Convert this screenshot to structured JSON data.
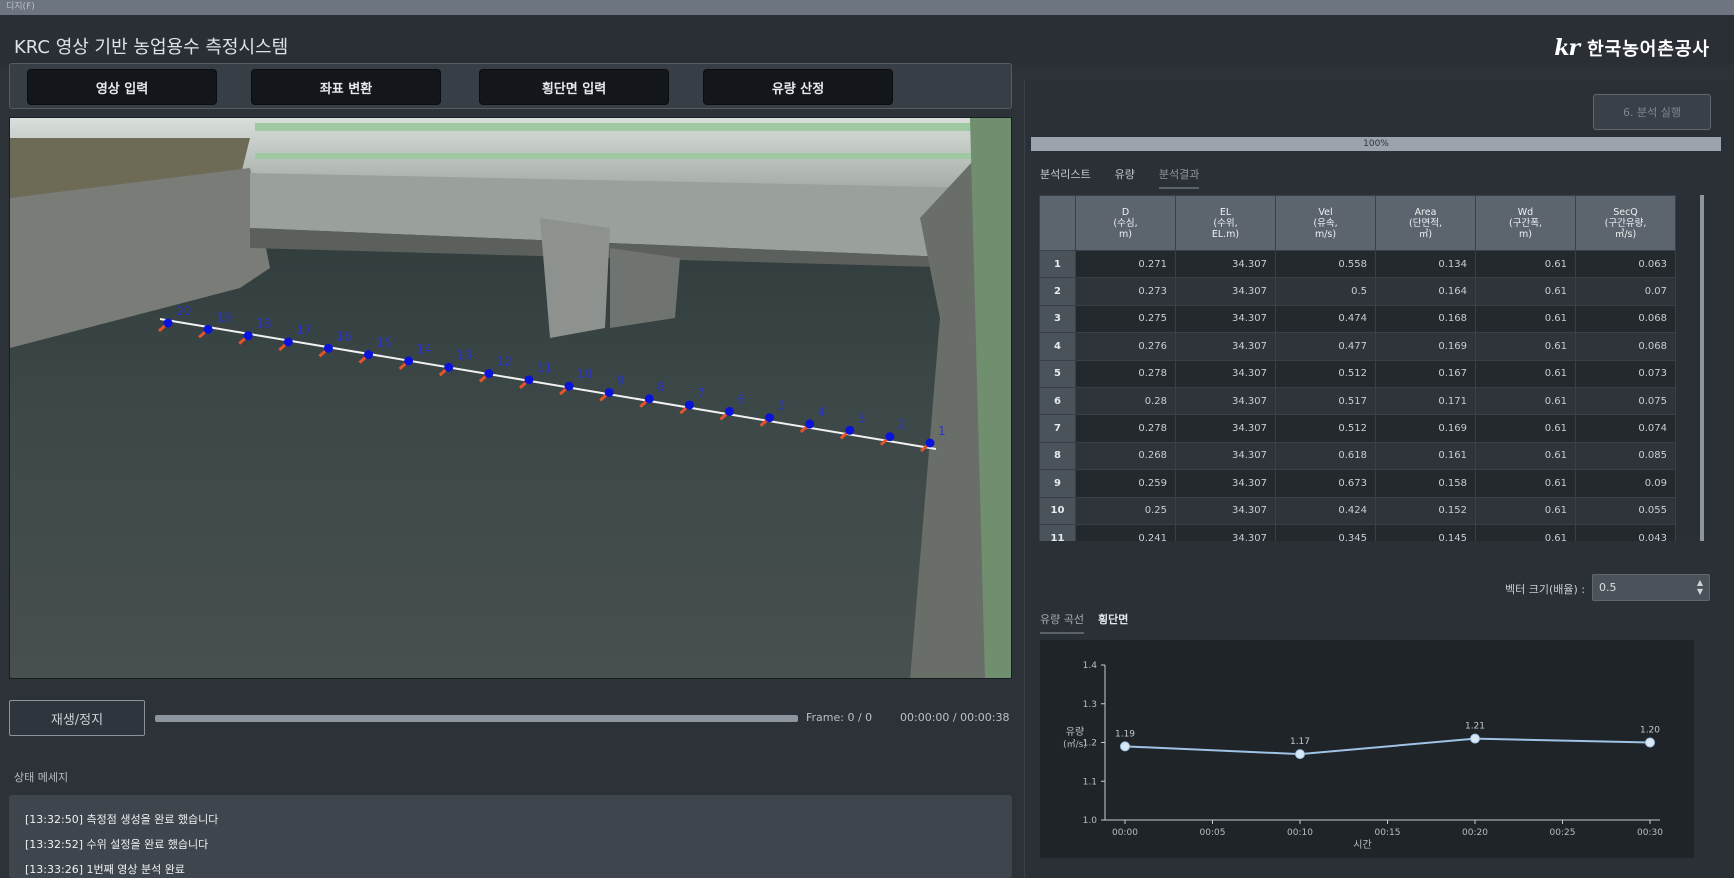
{
  "window": {
    "title": "디지(F)"
  },
  "app": {
    "title": "KRC 영상 기반 농업용수 측정시스템",
    "logo_mark": "kr",
    "logo_text": "한국농어촌공사"
  },
  "toolbar": {
    "buttons": [
      "영상 입력",
      "좌표 변환",
      "횡단면 입력",
      "유량 산정"
    ]
  },
  "video": {
    "point_labels": [
      "20",
      "19",
      "18",
      "17",
      "16",
      "15",
      "14",
      "13",
      "12",
      "11",
      "10",
      "9",
      "8",
      "7",
      "6",
      "5",
      "4",
      "3",
      "2",
      "1"
    ]
  },
  "playback": {
    "play_label": "재생/정지",
    "frame_label": "Frame: 0 / 0",
    "time_label": "00:00:00  /  00:00:38",
    "progress": 0
  },
  "status": {
    "title": "상태 메세지",
    "lines": [
      "[13:32:50] 측정점 생성을 완료 했습니다",
      "[13:32:52] 수위 설정을 완료 했습니다",
      "[13:33:26] 1번째 영상 분석 완료"
    ]
  },
  "analysis": {
    "run_label": "6. 분석 실행",
    "progress_percent": 100,
    "progress_text": "100%",
    "tabs": [
      "분석리스트",
      "유량",
      "분석결과"
    ],
    "active_tab": "분석결과"
  },
  "table": {
    "headers": [
      [
        "D",
        "(수심,",
        "m)"
      ],
      [
        "EL",
        "(수위,",
        "EL.m)"
      ],
      [
        "Vel",
        "(유속,",
        "m/s)"
      ],
      [
        "Area",
        "(단면적,",
        "㎡)"
      ],
      [
        "Wd",
        "(구간폭,",
        "m)"
      ],
      [
        "SecQ",
        "(구간유량,",
        "㎥/s)"
      ]
    ],
    "rows": [
      [
        "1",
        "0.271",
        "34.307",
        "0.558",
        "0.134",
        "0.61",
        "0.063"
      ],
      [
        "2",
        "0.273",
        "34.307",
        "0.5",
        "0.164",
        "0.61",
        "0.07"
      ],
      [
        "3",
        "0.275",
        "34.307",
        "0.474",
        "0.168",
        "0.61",
        "0.068"
      ],
      [
        "4",
        "0.276",
        "34.307",
        "0.477",
        "0.169",
        "0.61",
        "0.068"
      ],
      [
        "5",
        "0.278",
        "34.307",
        "0.512",
        "0.167",
        "0.61",
        "0.073"
      ],
      [
        "6",
        "0.28",
        "34.307",
        "0.517",
        "0.171",
        "0.61",
        "0.075"
      ],
      [
        "7",
        "0.278",
        "34.307",
        "0.512",
        "0.169",
        "0.61",
        "0.074"
      ],
      [
        "8",
        "0.268",
        "34.307",
        "0.618",
        "0.161",
        "0.61",
        "0.085"
      ],
      [
        "9",
        "0.259",
        "34.307",
        "0.673",
        "0.158",
        "0.61",
        "0.09"
      ],
      [
        "10",
        "0.25",
        "34.307",
        "0.424",
        "0.152",
        "0.61",
        "0.055"
      ],
      [
        "11",
        "0.241",
        "34.307",
        "0.345",
        "0.145",
        "0.61",
        "0.043"
      ]
    ]
  },
  "vector": {
    "label": "벡터 크기(배율) :",
    "value": "0.5"
  },
  "bottom_tabs": [
    "유량 곡선",
    "횡단면"
  ],
  "colors": {
    "line": "#9ec3e6",
    "marker": "#0a14d8",
    "arrow": "#e2542c"
  },
  "chart_data": {
    "type": "line",
    "x": [
      "00:00",
      "00:10",
      "00:20",
      "00:30"
    ],
    "values": [
      1.19,
      1.17,
      1.21,
      1.2
    ],
    "data_labels": [
      "1.19",
      "1.17",
      "1.21",
      "1.20"
    ],
    "x_ticks": [
      "00:00",
      "00:05",
      "00:10",
      "00:15",
      "00:20",
      "00:25",
      "00:30"
    ],
    "y_ticks": [
      "1.0",
      "1.1",
      "1.2",
      "1.3",
      "1.4"
    ],
    "ylim": [
      1.0,
      1.4
    ],
    "xlabel": "시간",
    "ylabel": [
      "유량",
      "(㎥/s)"
    ],
    "grid": false
  }
}
